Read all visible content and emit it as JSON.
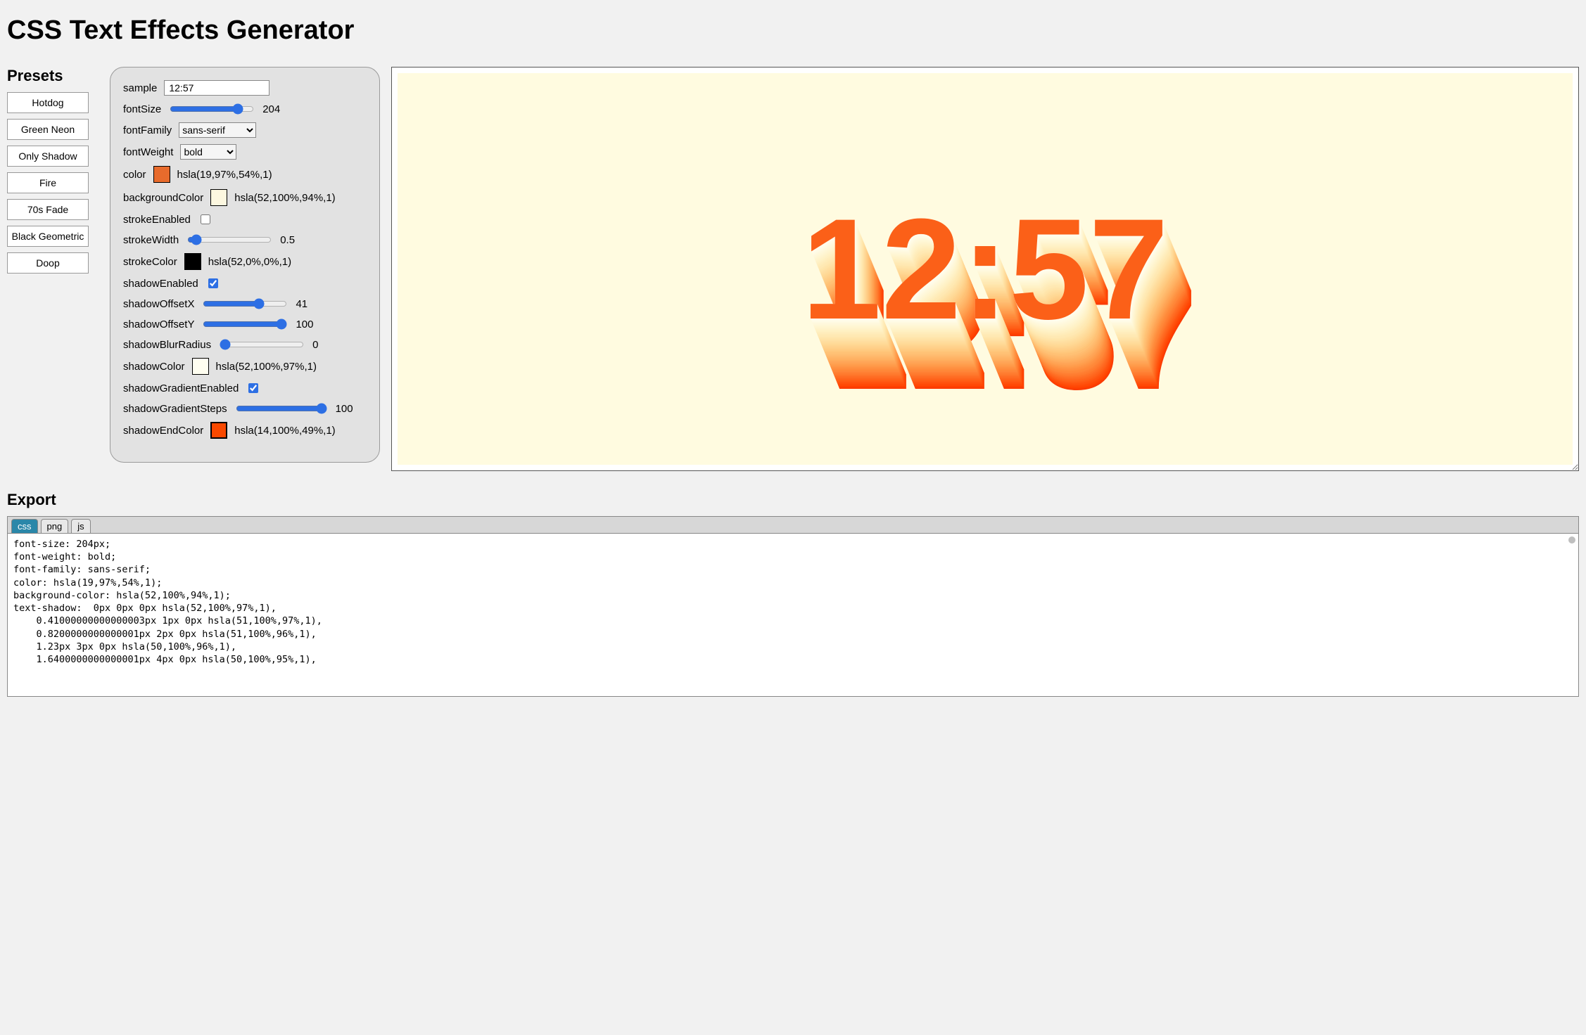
{
  "title": "CSS Text Effects Generator",
  "presets": {
    "heading": "Presets",
    "items": [
      "Hotdog",
      "Green Neon",
      "Only Shadow",
      "Fire",
      "70s Fade",
      "Black Geometric",
      "Doop"
    ]
  },
  "controls": {
    "sample": {
      "label": "sample",
      "value": "12:57"
    },
    "fontSize": {
      "label": "fontSize",
      "value": 204,
      "min": 0,
      "max": 240
    },
    "fontFamily": {
      "label": "fontFamily",
      "value": "sans-serif",
      "options": [
        "sans-serif"
      ]
    },
    "fontWeight": {
      "label": "fontWeight",
      "value": "bold",
      "options": [
        "bold"
      ]
    },
    "color": {
      "label": "color",
      "swatch": "#e86b2c",
      "text": "hsla(19,97%,54%,1)"
    },
    "backgroundColor": {
      "label": "backgroundColor",
      "swatch": "#fdf8e0",
      "text": "hsla(52,100%,94%,1)"
    },
    "strokeEnabled": {
      "label": "strokeEnabled",
      "checked": false
    },
    "strokeWidth": {
      "label": "strokeWidth",
      "value": 0.5,
      "min": 0,
      "max": 10
    },
    "strokeColor": {
      "label": "strokeColor",
      "swatch": "#000000",
      "text": "hsla(52,0%,0%,1)"
    },
    "shadowEnabled": {
      "label": "shadowEnabled",
      "checked": true
    },
    "shadowOffsetX": {
      "label": "shadowOffsetX",
      "value": 41,
      "min": 0,
      "max": 60
    },
    "shadowOffsetY": {
      "label": "shadowOffsetY",
      "value": 100,
      "min": 0,
      "max": 100
    },
    "shadowBlurRadius": {
      "label": "shadowBlurRadius",
      "value": 0,
      "min": 0,
      "max": 100
    },
    "shadowColor": {
      "label": "shadowColor",
      "swatch": "#fffef0",
      "text": "hsla(52,100%,97%,1)"
    },
    "shadowGradientEnabled": {
      "label": "shadowGradientEnabled",
      "checked": true
    },
    "shadowGradientSteps": {
      "label": "shadowGradientSteps",
      "value": 100,
      "min": 0,
      "max": 100
    },
    "shadowEndColor": {
      "label": "shadowEndColor",
      "swatch": "#fa4900",
      "text": "hsla(14,100%,49%,1)"
    }
  },
  "preview": {
    "text": "12:57",
    "fontSize": 204,
    "color": "hsla(19,97%,54%,1)",
    "background": "hsla(52,100%,94%,1)"
  },
  "export": {
    "heading": "Export",
    "tabs": [
      "css",
      "png",
      "js"
    ],
    "active_tab": "css",
    "css_lines": [
      "font-size: 204px;",
      "font-weight: bold;",
      "font-family: sans-serif;",
      "color: hsla(19,97%,54%,1);",
      "background-color: hsla(52,100%,94%,1);",
      "text-shadow:  0px 0px 0px hsla(52,100%,97%,1),",
      "    0.41000000000000003px 1px 0px hsla(51,100%,97%,1),",
      "    0.8200000000000001px 2px 0px hsla(51,100%,96%,1),",
      "    1.23px 3px 0px hsla(50,100%,96%,1),",
      "    1.6400000000000001px 4px 0px hsla(50,100%,95%,1),"
    ]
  }
}
